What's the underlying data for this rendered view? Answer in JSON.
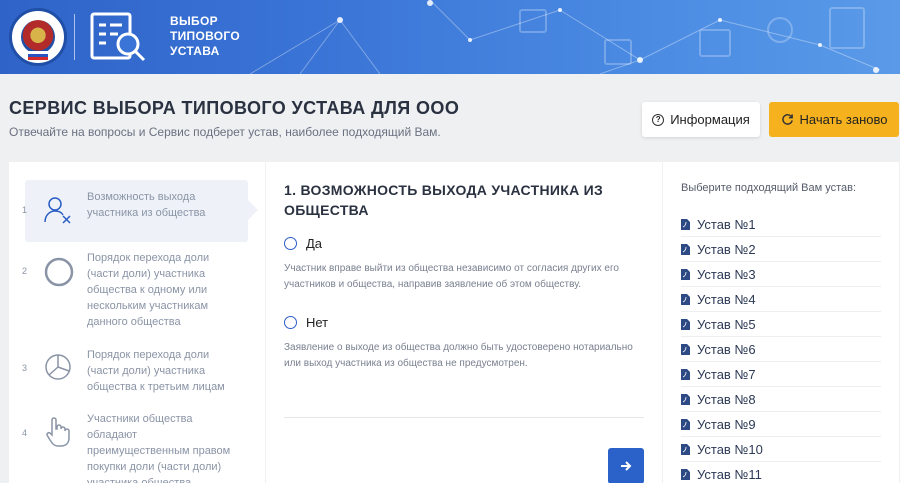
{
  "header": {
    "brand_lines": [
      "ВЫБОР",
      "ТИПОВОГО",
      "УСТАВА"
    ]
  },
  "page": {
    "title": "СЕРВИС ВЫБОРА ТИПОВОГО УСТАВА ДЛЯ ООО",
    "subtitle": "Отвечайте на вопросы и Сервис подберет устав, наиболее подходящий Вам."
  },
  "buttons": {
    "info_label": "Информация",
    "restart_label": "Начать заново",
    "next_icon": "arrow-right-icon"
  },
  "steps": [
    {
      "num": "1",
      "text": "Возможность выхода участника из общества",
      "icon": "user-remove-icon"
    },
    {
      "num": "2",
      "text": "Порядок перехода доли (части доли) участника общества к одному или нескольким участникам данного общества",
      "icon": "circle-icon"
    },
    {
      "num": "3",
      "text": "Порядок перехода доли (части доли) участника общества к третьим лицам",
      "icon": "pie-chart-icon"
    },
    {
      "num": "4",
      "text": "Участники общества обладают преимущественным правом покупки доли (части доли) участника общества",
      "icon": "hand-pointer-icon"
    }
  ],
  "question": {
    "title": "1. ВОЗМОЖНОСТЬ ВЫХОДА УЧАСТНИКА ИЗ ОБЩЕСТВА",
    "options": [
      {
        "label": "Да",
        "hint": "Участник вправе выйти из общества независимо от согласия других его участников и общества, направив заявление об этом обществу."
      },
      {
        "label": "Нет",
        "hint": "Заявление о выходе из общества должно быть удостоверено нотариально или выход участника из общества не предусмотрен."
      }
    ]
  },
  "ustavs": {
    "label": "Выберите подходящий Вам устав:",
    "items": [
      "Устав №1",
      "Устав №2",
      "Устав №3",
      "Устав №4",
      "Устав №5",
      "Устав №6",
      "Устав №7",
      "Устав №8",
      "Устав №9",
      "Устав №10",
      "Устав №11"
    ]
  },
  "colors": {
    "primary": "#2a62c9",
    "accent": "#f6b21e",
    "banner": "#3a74d6"
  }
}
